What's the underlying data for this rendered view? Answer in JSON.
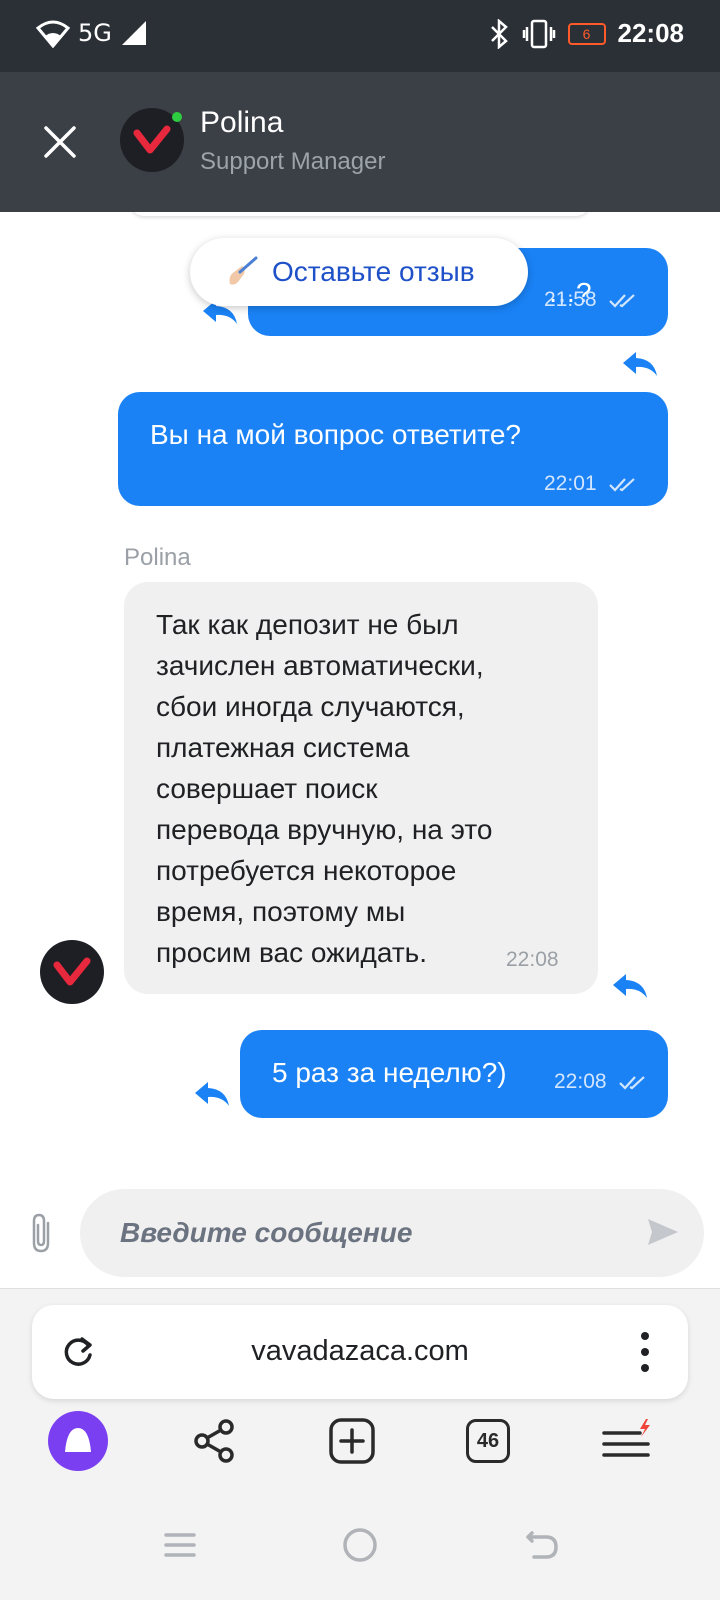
{
  "status_bar": {
    "network": "5G",
    "battery_level": "6",
    "time": "22:08"
  },
  "header": {
    "agent_name": "Polina",
    "agent_role": "Support Manager"
  },
  "feedback": {
    "label": "Оставьте отзыв"
  },
  "messages": [
    {
      "direction": "outgoing",
      "text": "…?",
      "time": "21:58"
    },
    {
      "direction": "outgoing",
      "text": "Вы на мой вопрос ответите?",
      "time": "22:01"
    },
    {
      "direction": "incoming",
      "sender": "Polina",
      "lines": [
        "Так как депозит не был",
        "зачислен автоматически,",
        "сбои иногда случаются,",
        "платежная система",
        "совершает поиск",
        "перевода вручную, на это",
        "потребуется некоторое",
        "время, поэтому мы",
        "просим вас ожидать."
      ],
      "time": "22:08"
    },
    {
      "direction": "outgoing",
      "text": "5 раз за неделю?)",
      "time": "22:08"
    }
  ],
  "composer": {
    "placeholder": "Введите сообщение"
  },
  "browser": {
    "url": "vavadazaca.com",
    "tabs_count": "46"
  },
  "colors": {
    "outgoing_bubble": "#1a82f5",
    "incoming_bubble": "#f0f0f0",
    "header": "#3b3f46",
    "status_bar": "#2b2f36",
    "brand_red": "#e8283c",
    "alice_purple": "#7b3ff2"
  }
}
